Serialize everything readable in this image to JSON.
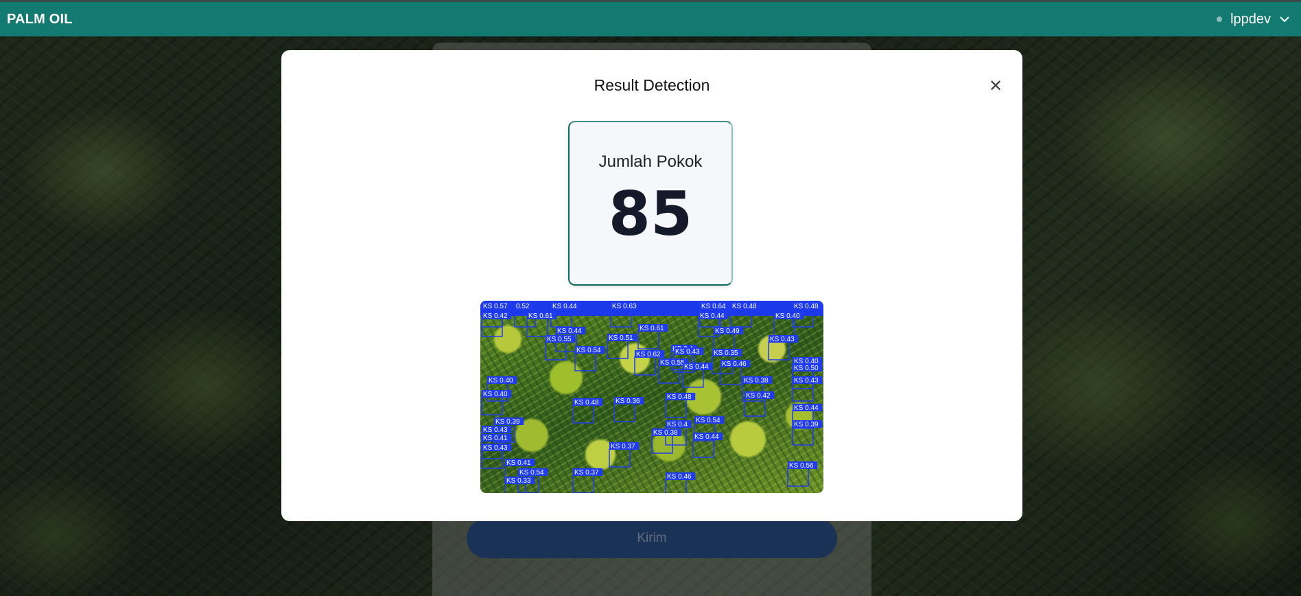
{
  "header": {
    "brand": "PALM OIL",
    "user": "lppdev"
  },
  "modal": {
    "title": "Result Detection",
    "count_label": "Jumlah Pokok",
    "count_value": "85"
  },
  "form": {
    "submit_label": "Kirim"
  },
  "detections": [
    {
      "label": "KS 0.57"
    },
    {
      "label": "0.52"
    },
    {
      "label": "KS 0.44"
    },
    {
      "label": "KS 0.63"
    },
    {
      "label": "KS 0.64"
    },
    {
      "label": "KS 0.48"
    },
    {
      "label": "KS 0.48"
    },
    {
      "label": "KS 0.42"
    },
    {
      "label": "KS 0.61"
    },
    {
      "label": "KS 0.44"
    },
    {
      "label": "KS 0.40"
    },
    {
      "label": "KS 0.44"
    },
    {
      "label": "KS 0.49"
    },
    {
      "label": "KS 0.61"
    },
    {
      "label": "KS 0.43"
    },
    {
      "label": "KS 0.51"
    },
    {
      "label": "KS 0.55"
    },
    {
      "label": "KS 0.4"
    },
    {
      "label": "KS 0.54"
    },
    {
      "label": "KS 0.62"
    },
    {
      "label": "KS 0.43"
    },
    {
      "label": "KS 0.35"
    },
    {
      "label": "KS 0.40"
    },
    {
      "label": "KS 0.55"
    },
    {
      "label": "KS 0.44"
    },
    {
      "label": "KS 0.46"
    },
    {
      "label": "KS 0.50"
    },
    {
      "label": "KS 0.40"
    },
    {
      "label": "KS 0.38"
    },
    {
      "label": "KS 0.43"
    },
    {
      "label": "KS 0.40"
    },
    {
      "label": "KS 0.48"
    },
    {
      "label": "KS 0.42"
    },
    {
      "label": "KS 0.48"
    },
    {
      "label": "KS 0.36"
    },
    {
      "label": "KS 0.44"
    },
    {
      "label": "KS 0.39"
    },
    {
      "label": "KS 0.43"
    },
    {
      "label": "KS 0.41"
    },
    {
      "label": "KS 0.4"
    },
    {
      "label": "KS 0.43"
    },
    {
      "label": "KS 0.54"
    },
    {
      "label": "KS 0.39"
    },
    {
      "label": "KS 0.38"
    },
    {
      "label": "KS 0.37"
    },
    {
      "label": "KS 0.44"
    },
    {
      "label": "KS 0.41"
    },
    {
      "label": "KS 0.54"
    },
    {
      "label": "KS 0.33"
    },
    {
      "label": "KS 0.37"
    },
    {
      "label": "KS 0.46"
    },
    {
      "label": "KS 0.56"
    }
  ]
}
